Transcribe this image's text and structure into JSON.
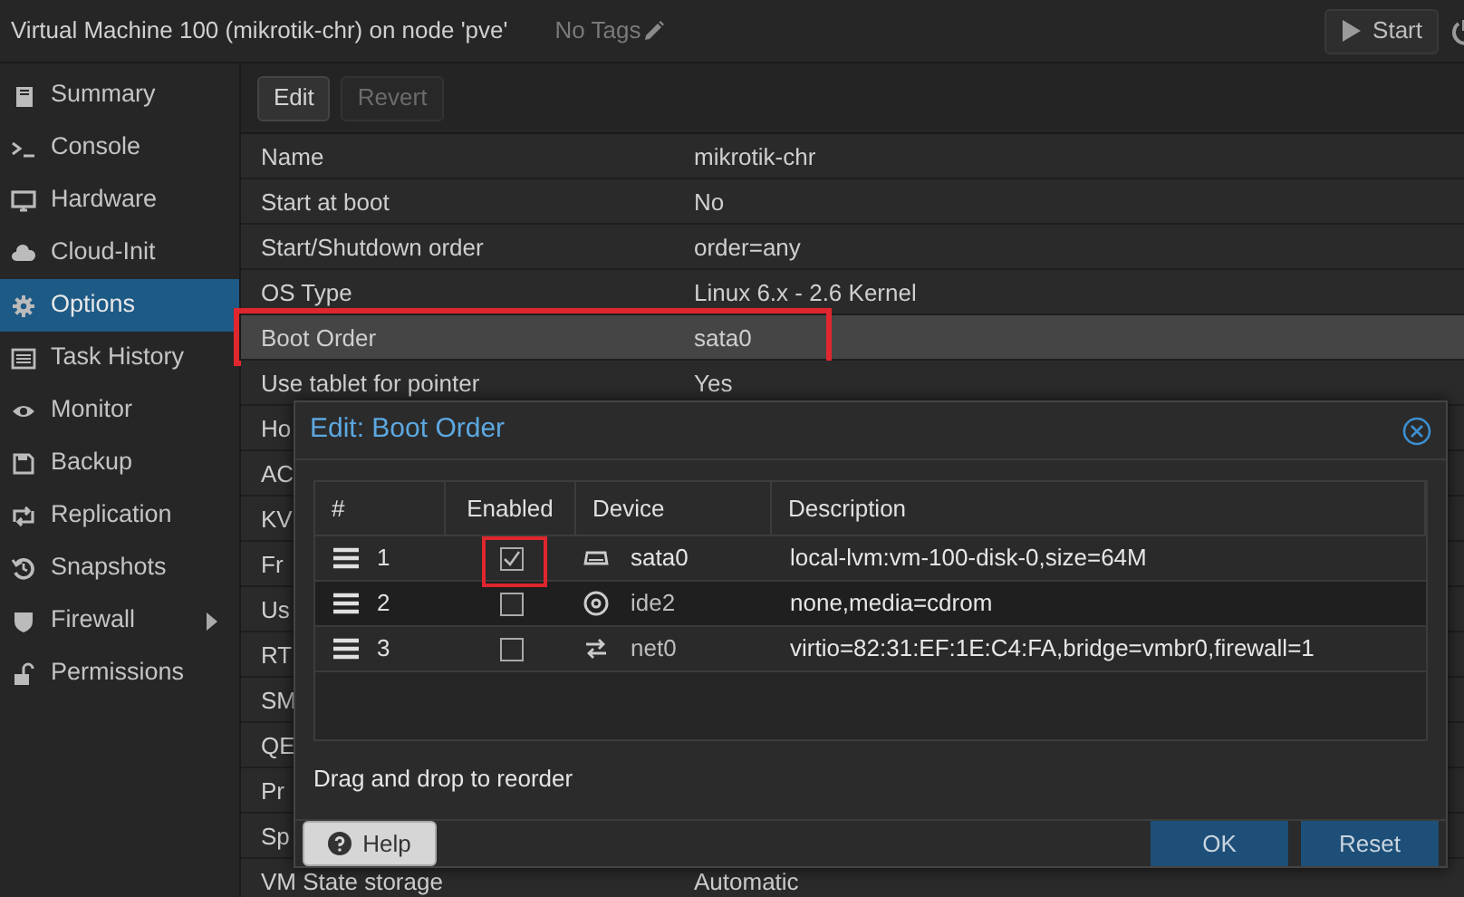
{
  "window": {
    "title": "Virtual Machine 100 (mikrotik-chr) on node 'pve'",
    "tags": "No Tags",
    "start_button": "Start"
  },
  "sidebar": {
    "items": [
      {
        "label": "Summary",
        "selected": false,
        "submenu": false
      },
      {
        "label": "Console",
        "selected": false,
        "submenu": false
      },
      {
        "label": "Hardware",
        "selected": false,
        "submenu": false
      },
      {
        "label": "Cloud-Init",
        "selected": false,
        "submenu": false
      },
      {
        "label": "Options",
        "selected": true,
        "submenu": false
      },
      {
        "label": "Task History",
        "selected": false,
        "submenu": false
      },
      {
        "label": "Monitor",
        "selected": false,
        "submenu": false
      },
      {
        "label": "Backup",
        "selected": false,
        "submenu": false
      },
      {
        "label": "Replication",
        "selected": false,
        "submenu": false
      },
      {
        "label": "Snapshots",
        "selected": false,
        "submenu": false
      },
      {
        "label": "Firewall",
        "selected": false,
        "submenu": true
      },
      {
        "label": "Permissions",
        "selected": false,
        "submenu": false
      }
    ]
  },
  "options_toolbar": [
    {
      "label": "Edit",
      "disabled": false
    },
    {
      "label": "Revert",
      "disabled": true
    }
  ],
  "options": [
    {
      "name": "Name",
      "value": "mikrotik-chr",
      "selected": false,
      "highlighted": false
    },
    {
      "name": "Start at boot",
      "value": "No",
      "selected": false,
      "highlighted": false
    },
    {
      "name": "Start/Shutdown order",
      "value": "order=any",
      "selected": false,
      "highlighted": false
    },
    {
      "name": "OS Type",
      "value": "Linux 6.x - 2.6 Kernel",
      "selected": false,
      "highlighted": false
    },
    {
      "name": "Boot Order",
      "value": "sata0",
      "selected": true,
      "highlighted": true
    },
    {
      "name": "Use tablet for pointer",
      "value": "Yes",
      "selected": false,
      "highlighted": false
    },
    {
      "name": "Ho",
      "selected": false,
      "highlighted": false
    },
    {
      "name": "AC",
      "selected": false,
      "highlighted": false
    },
    {
      "name": "KV",
      "selected": false,
      "highlighted": false
    },
    {
      "name": "Fr",
      "selected": false,
      "highlighted": false
    },
    {
      "name": "Us",
      "selected": false,
      "highlighted": false
    },
    {
      "name": "RT",
      "selected": false,
      "highlighted": false
    },
    {
      "name": "SM",
      "selected": false,
      "highlighted": false
    },
    {
      "name": "QE",
      "selected": false,
      "highlighted": false
    },
    {
      "name": "Pr",
      "selected": false,
      "highlighted": false
    },
    {
      "name": "Sp",
      "selected": false,
      "highlighted": false
    },
    {
      "name": "VM State storage",
      "value": "Automatic",
      "selected": false,
      "highlighted": false
    }
  ],
  "dialog": {
    "title": "Edit: Boot Order",
    "columns": [
      "#",
      "Enabled",
      "Device",
      "Description"
    ],
    "rows": [
      {
        "number": "1",
        "enabled": true,
        "device": "sata0",
        "description": "local-lvm:vm-100-disk-0,size=64M",
        "highlighted": true
      },
      {
        "number": "2",
        "enabled": false,
        "device": "ide2",
        "description": "none,media=cdrom",
        "highlighted": false
      },
      {
        "number": "3",
        "enabled": false,
        "device": "net0",
        "description": "virtio=82:31:EF:1E:C4:FA,bridge=vmbr0,firewall=1",
        "highlighted": false
      }
    ],
    "hint": "Drag and drop to reorder",
    "buttons": [
      {
        "label": "Help",
        "kind": "help"
      },
      {
        "label": "OK",
        "kind": "primary"
      },
      {
        "label": "Reset",
        "kind": "primary"
      }
    ]
  }
}
